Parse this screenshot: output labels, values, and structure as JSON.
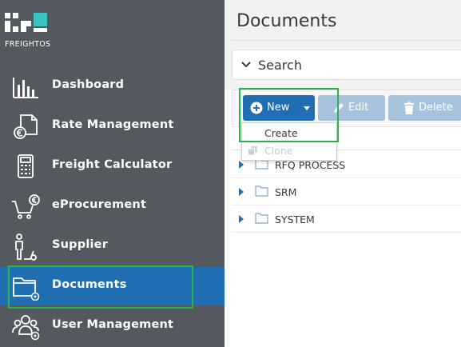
{
  "brand": {
    "name": "FREIGHTOS",
    "accent": "#3cc4c4",
    "sidebar_bg": "#545960",
    "active_bg": "#1f6fb2",
    "highlight": "#2bb24c"
  },
  "sidebar": {
    "items": [
      {
        "label": "Dashboard",
        "icon": "bar-chart-icon",
        "active": false
      },
      {
        "label": "Rate Management",
        "icon": "rate-document-euro-icon",
        "active": false
      },
      {
        "label": "Freight Calculator",
        "icon": "calculator-icon",
        "active": false
      },
      {
        "label": "eProcurement",
        "icon": "cart-euro-icon",
        "active": false
      },
      {
        "label": "Supplier",
        "icon": "person-wheelchair-icon",
        "active": false
      },
      {
        "label": "Documents",
        "icon": "folder-gear-icon",
        "active": true
      },
      {
        "label": "User Management",
        "icon": "users-gear-icon",
        "active": false
      }
    ]
  },
  "main": {
    "title": "Documents",
    "search": {
      "label": "Search"
    },
    "toolbar": {
      "new_label": "New",
      "edit_label": "Edit",
      "delete_label": "Delete"
    },
    "new_menu": {
      "create_label": "Create",
      "clone_label": "Clone"
    },
    "tree": [
      {
        "name": "RFQ PROCESS"
      },
      {
        "name": "SRM"
      },
      {
        "name": "SYSTEM"
      }
    ]
  }
}
